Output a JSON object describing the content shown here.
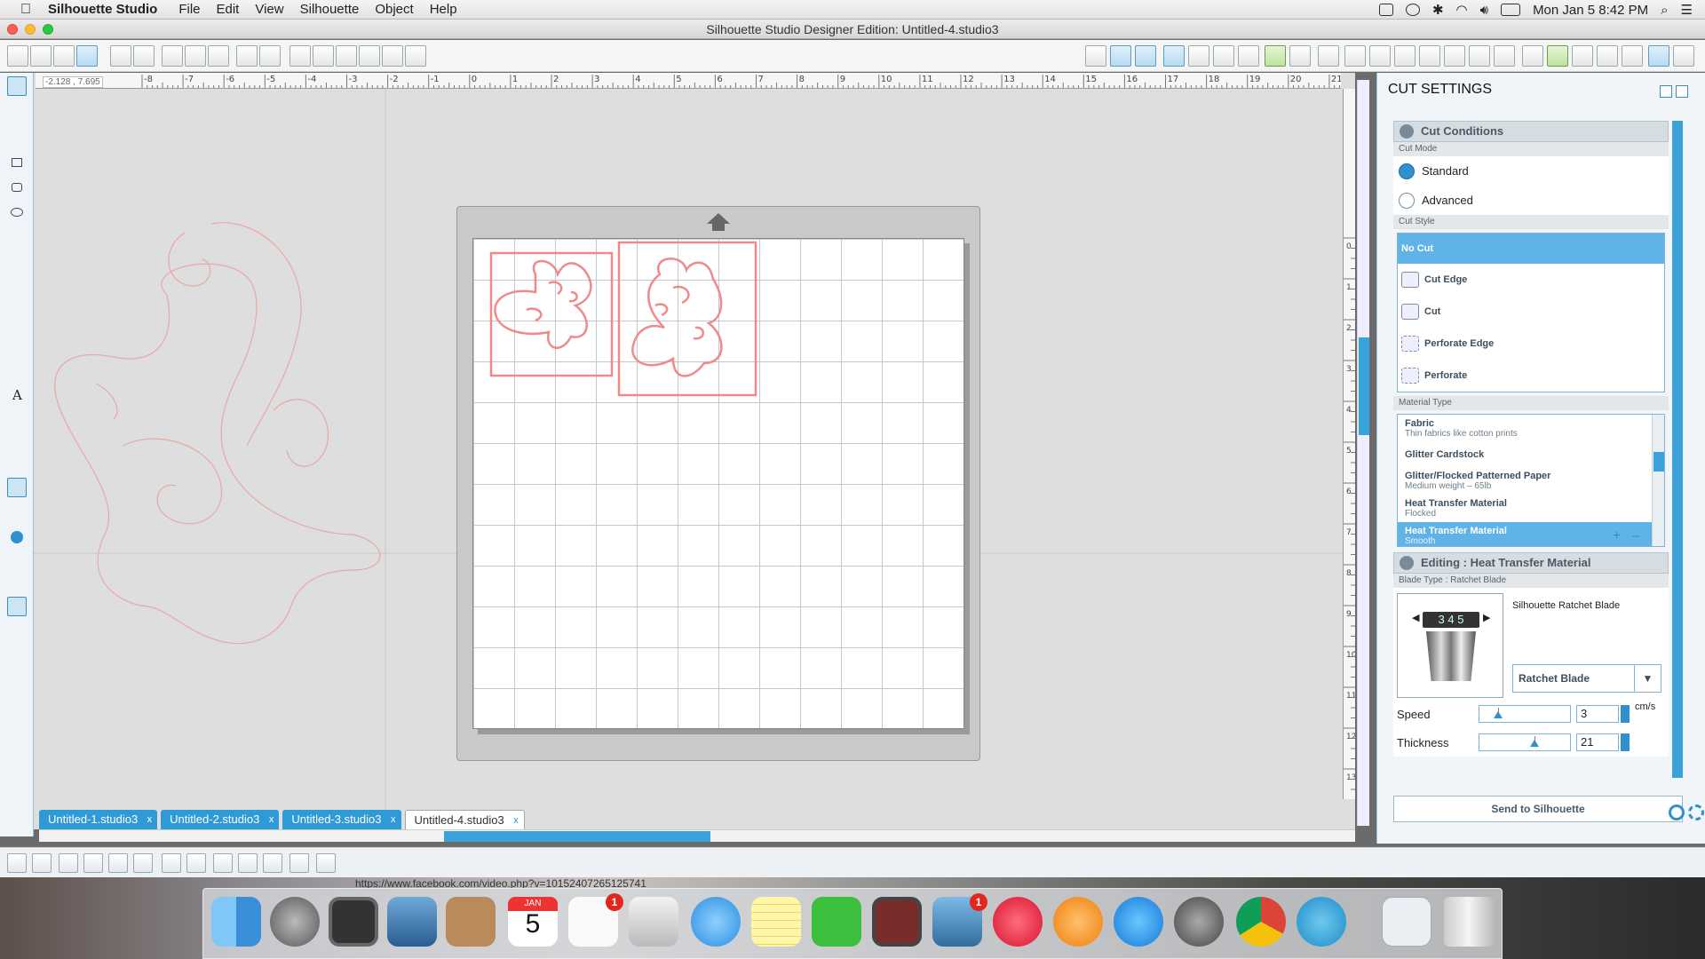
{
  "menubar": {
    "app_name": "Silhouette Studio",
    "items": [
      "File",
      "Edit",
      "View",
      "Silhouette",
      "Object",
      "Help"
    ],
    "clock": "Mon Jan 5  8:42 PM"
  },
  "window": {
    "title": "Silhouette Studio Designer Edition: Untitled-4.studio3"
  },
  "canvas": {
    "coord_readout": "-2.128 , 7.695",
    "ruler_h_labels": [
      "-8",
      "-7",
      "-6",
      "-5",
      "-4",
      "-3",
      "-2",
      "-1",
      "0",
      "1",
      "2",
      "3",
      "4",
      "5",
      "6",
      "7",
      "8",
      "9",
      "10",
      "11",
      "12",
      "13",
      "14",
      "15",
      "16",
      "17",
      "18",
      "19",
      "20",
      "21"
    ],
    "ruler_v_labels": [
      "0",
      "1",
      "2",
      "3",
      "4",
      "5",
      "6",
      "7",
      "8",
      "9",
      "10",
      "11",
      "12",
      "13"
    ]
  },
  "tabs": [
    {
      "label": "Untitled-1.studio3",
      "close": "x",
      "active": false
    },
    {
      "label": "Untitled-2.studio3",
      "close": "x",
      "active": false
    },
    {
      "label": "Untitled-3.studio3",
      "close": "x",
      "active": false
    },
    {
      "label": "Untitled-4.studio3",
      "close": "x",
      "active": true
    }
  ],
  "panel": {
    "title": "CUT SETTINGS",
    "cut_conditions": {
      "heading": "Cut Conditions",
      "mode_label": "Cut Mode",
      "modes": [
        {
          "label": "Standard",
          "selected": true
        },
        {
          "label": "Advanced",
          "selected": false
        }
      ],
      "style_label": "Cut Style",
      "styles": [
        {
          "label": "No Cut",
          "selected": true
        },
        {
          "label": "Cut Edge",
          "selected": false
        },
        {
          "label": "Cut",
          "selected": false
        },
        {
          "label": "Perforate Edge",
          "selected": false
        },
        {
          "label": "Perforate",
          "selected": false
        }
      ],
      "material_label": "Material Type",
      "materials": [
        {
          "name": "Fabric",
          "sub": "Thin fabrics like cotton prints",
          "selected": false
        },
        {
          "name": "Glitter Cardstock",
          "sub": "",
          "selected": false
        },
        {
          "name": "Glitter/Flocked Patterned Paper",
          "sub": "Medium weight – 65lb",
          "selected": false
        },
        {
          "name": "Heat Transfer Material",
          "sub": "Flocked",
          "selected": false
        },
        {
          "name": "Heat Transfer Material",
          "sub": "Smooth",
          "selected": true
        }
      ],
      "add_symbol": "+",
      "remove_symbol": "–"
    },
    "editing": {
      "heading": "Editing : Heat Transfer Material",
      "blade_type_label": "Blade Type : Ratchet Blade",
      "blade_name": "Silhouette Ratchet Blade",
      "blade_dial": "3 4 5",
      "blade_select": "Ratchet Blade",
      "speed_label": "Speed",
      "speed_value": "3",
      "speed_fraction": 0.2,
      "speed_unit": "cm/s",
      "thickness_label": "Thickness",
      "thickness_value": "21",
      "thickness_fraction": 0.6
    },
    "send_button": "Send to Silhouette"
  },
  "dock": {
    "url_hint": "https://www.facebook.com/video.php?v=10152407265125741",
    "calendar_month": "JAN",
    "calendar_day": "5",
    "reminders_badge": "1",
    "photo_badge": "1",
    "icons": [
      "finder-icon",
      "launchpad-icon",
      "photo-booth-icon",
      "mail-icon",
      "contacts-icon",
      "calendar-icon",
      "reminders-icon",
      "preview-icon",
      "messages-icon",
      "notes-icon",
      "facetime-icon",
      "photos-icon",
      "iphoto-icon",
      "itunes-icon",
      "ibooks-icon",
      "app-store-icon",
      "system-preferences-icon",
      "chrome-icon",
      "silhouette-icon",
      "silhouette-doc-icon",
      "trash-icon"
    ]
  },
  "colors": {
    "accent": "#2e9bd6",
    "design_stroke": "#f08a8a",
    "canvas_bg": "#dedede"
  }
}
